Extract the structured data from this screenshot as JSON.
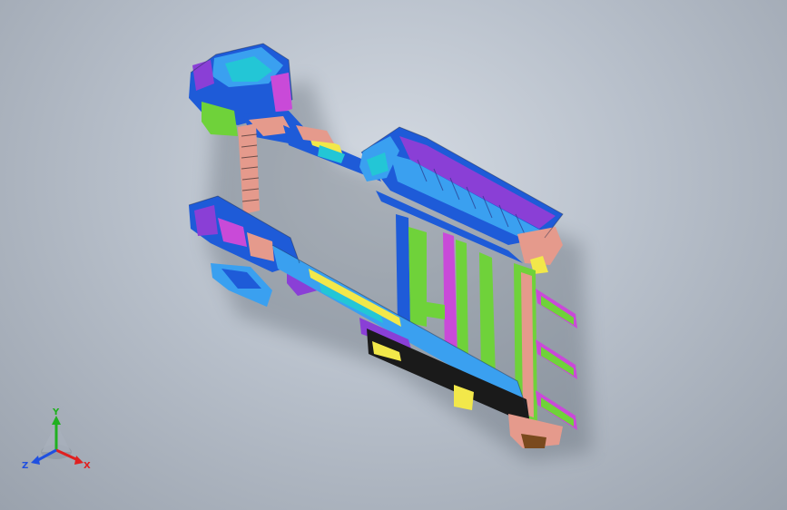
{
  "viewport": {
    "background_top": "#d4dae2",
    "background_bottom": "#9aa2ad"
  },
  "model": {
    "description_icon": "cad-assembly-frame",
    "palette": [
      "#1e5bd8",
      "#3aa0f0",
      "#23c6d6",
      "#c94ad8",
      "#8a3fd6",
      "#6fd23a",
      "#f2e84a",
      "#e59a8c",
      "#1a1a1a",
      "#7a4a1e"
    ]
  },
  "triad": {
    "x_label": "X",
    "y_label": "Y",
    "z_label": "Z",
    "x_color": "#e02020",
    "y_color": "#20b020",
    "z_color": "#2050e0"
  }
}
